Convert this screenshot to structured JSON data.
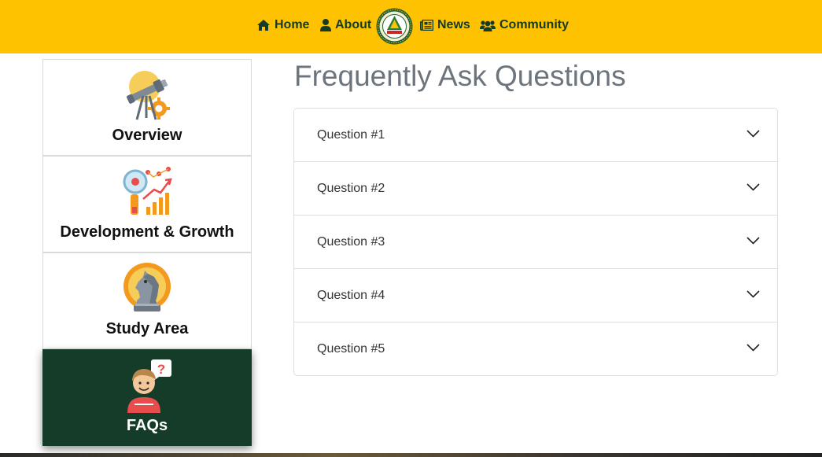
{
  "nav": {
    "home": "Home",
    "about": "About",
    "news": "News",
    "community": "Community",
    "logo_icon": "school-seal-logo"
  },
  "sidebar": {
    "items": [
      {
        "label": "Overview",
        "icon": "telescope-gear-icon"
      },
      {
        "label": "Development & Growth",
        "icon": "growth-chart-icon"
      },
      {
        "label": "Study Area",
        "icon": "chess-knight-icon"
      },
      {
        "label": "FAQs",
        "icon": "person-question-icon",
        "active": true
      }
    ]
  },
  "main": {
    "title": "Frequently Ask Questions",
    "faq": [
      {
        "question": "Question #1"
      },
      {
        "question": "Question #2"
      },
      {
        "question": "Question #3"
      },
      {
        "question": "Question #4"
      },
      {
        "question": "Question #5"
      }
    ]
  },
  "colors": {
    "topbar": "#ffc200",
    "nav_text": "#143c28",
    "active_card": "#143c28",
    "title": "#6c757d"
  }
}
